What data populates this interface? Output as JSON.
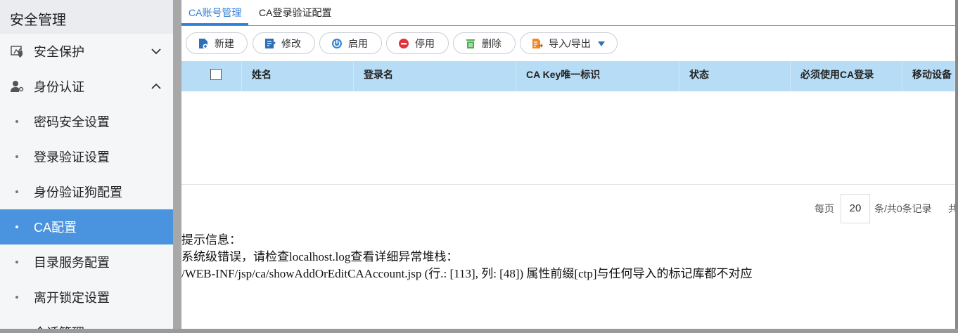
{
  "sidebar": {
    "title": "安全管理",
    "groups": [
      {
        "label": "安全保护",
        "icon": "shield-icon",
        "expanded": false
      },
      {
        "label": "身份认证",
        "icon": "user-key-icon",
        "expanded": true
      }
    ],
    "items": [
      {
        "label": "密码安全设置",
        "active": false
      },
      {
        "label": "登录验证设置",
        "active": false
      },
      {
        "label": "身份验证狗配置",
        "active": false
      },
      {
        "label": "CA配置",
        "active": true
      },
      {
        "label": "目录服务配置",
        "active": false
      },
      {
        "label": "离开锁定设置",
        "active": false
      }
    ],
    "next_group_partial": "会话管理"
  },
  "tabs": [
    {
      "label": "CA账号管理",
      "active": true
    },
    {
      "label": "CA登录验证配置",
      "active": false
    }
  ],
  "toolbar": {
    "new_label": "新建",
    "edit_label": "修改",
    "enable_label": "启用",
    "disable_label": "停用",
    "delete_label": "删除",
    "import_export_label": "导入/导出"
  },
  "table": {
    "columns": [
      "姓名",
      "登录名",
      "CA Key唯一标识",
      "状态",
      "必须使用CA登录",
      "移动设备"
    ],
    "rows": []
  },
  "pager": {
    "per_page_label": "每页",
    "page_size": "20",
    "records_label": "条/共0条记录",
    "total_label": "共"
  },
  "error": {
    "line1": "提示信息：",
    "line2": "系统级错误，请检查localhost.log查看详细异常堆栈：",
    "line3": "/WEB-INF/jsp/ca/showAddOrEditCAAccount.jsp (行.: [113], 列: [48]) 属性前缀[ctp]与任何导入的标记库都不对应"
  },
  "colors": {
    "accent": "#4a93de",
    "header_bg": "#b7dcf6",
    "sidebar_bg": "#f5f6f8"
  }
}
